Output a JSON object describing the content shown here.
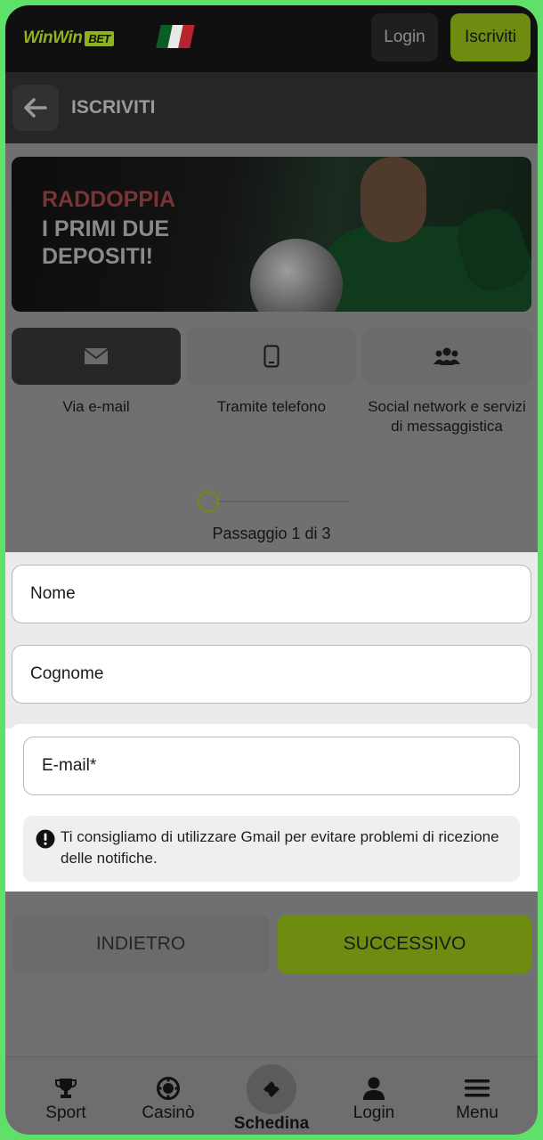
{
  "header": {
    "logo_part1": "Win",
    "logo_part2": "Win",
    "logo_badge": "BET",
    "login_label": "Login",
    "signup_label": "Iscriviti"
  },
  "subheader": {
    "title": "ISCRIVITI"
  },
  "banner": {
    "line1": "RADDOPPIA",
    "line2": "I PRIMI DUE DEPOSITI!"
  },
  "methods": [
    {
      "label": "Via e-mail",
      "icon": "envelope-icon",
      "selected": true
    },
    {
      "label": "Tramite telefono",
      "icon": "phone-icon",
      "selected": false
    },
    {
      "label": "Social network e servizi di messaggistica",
      "icon": "users-icon",
      "selected": false
    }
  ],
  "steps": {
    "text": "Passaggio 1 di 3",
    "current": 1,
    "total": 3
  },
  "form": {
    "name_placeholder": "Nome",
    "surname_placeholder": "Cognome",
    "email_placeholder": "E-mail*",
    "hint": "Ti consigliamo di utilizzare Gmail per evitare problemi di ricezione delle notifiche."
  },
  "actions": {
    "back_label": "INDIETRO",
    "next_label": "SUCCESSIVO"
  },
  "bottom_nav": {
    "items": [
      {
        "label": "Sport",
        "icon": "trophy-icon"
      },
      {
        "label": "Casinò",
        "icon": "chip-icon"
      },
      {
        "label": "Schedina",
        "icon": "ticket-icon"
      },
      {
        "label": "Login",
        "icon": "user-icon"
      },
      {
        "label": "Menu",
        "icon": "menu-icon"
      }
    ]
  },
  "colors": {
    "accent": "#8fb31a",
    "accent_dim": "#6e8d10",
    "frame": "#5ee06a"
  }
}
